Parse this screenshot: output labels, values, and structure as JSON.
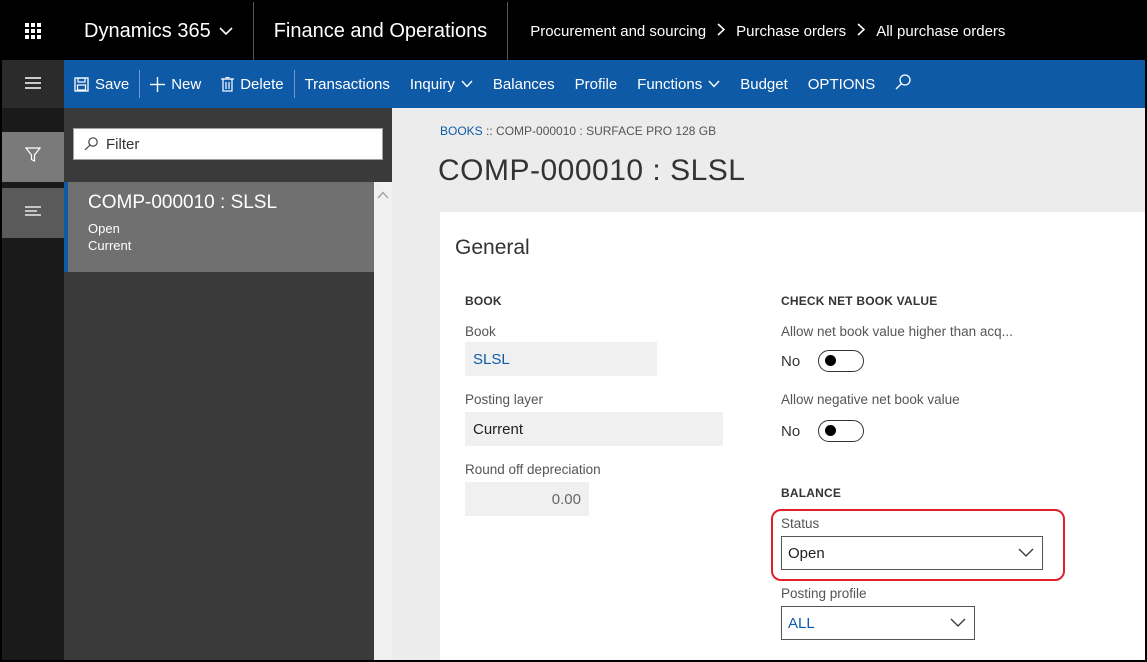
{
  "topbar": {
    "waffle_icon": "app-launcher-icon",
    "brand": "Dynamics 365",
    "module": "Finance and Operations",
    "breadcrumbs": [
      "Procurement and sourcing",
      "Purchase orders",
      "All purchase orders"
    ]
  },
  "actionbar": {
    "save": "Save",
    "new": "New",
    "delete": "Delete",
    "transactions": "Transactions",
    "inquiry": "Inquiry",
    "balances": "Balances",
    "profile": "Profile",
    "functions": "Functions",
    "budget": "Budget",
    "options": "OPTIONS"
  },
  "list": {
    "filter_placeholder": "Filter",
    "items": [
      {
        "title": "COMP-000010 : SLSL",
        "line1": "Open",
        "line2": "Current"
      }
    ]
  },
  "content": {
    "breadcrumb_link": "BOOKS",
    "breadcrumb_rest": " :: COMP-000010 : SURFACE PRO 128 GB",
    "title": "COMP-000010 : SLSL",
    "section_title": "General",
    "book": {
      "header": "BOOK",
      "book_label": "Book",
      "book_value": "SLSL",
      "posting_layer_label": "Posting layer",
      "posting_layer_value": "Current",
      "round_off_label": "Round off depreciation",
      "round_off_value": "0.00"
    },
    "check_nbv": {
      "header": "CHECK NET BOOK VALUE",
      "allow_higher_label": "Allow net book value higher than acq...",
      "allow_higher_value": "No",
      "allow_negative_label": "Allow negative net book value",
      "allow_negative_value": "No"
    },
    "balance": {
      "header": "BALANCE",
      "status_label": "Status",
      "status_value": "Open",
      "posting_profile_label": "Posting profile",
      "posting_profile_value": "ALL"
    }
  },
  "colors": {
    "brand_blue": "#0f5aa7",
    "highlight_red": "#e0202a"
  }
}
